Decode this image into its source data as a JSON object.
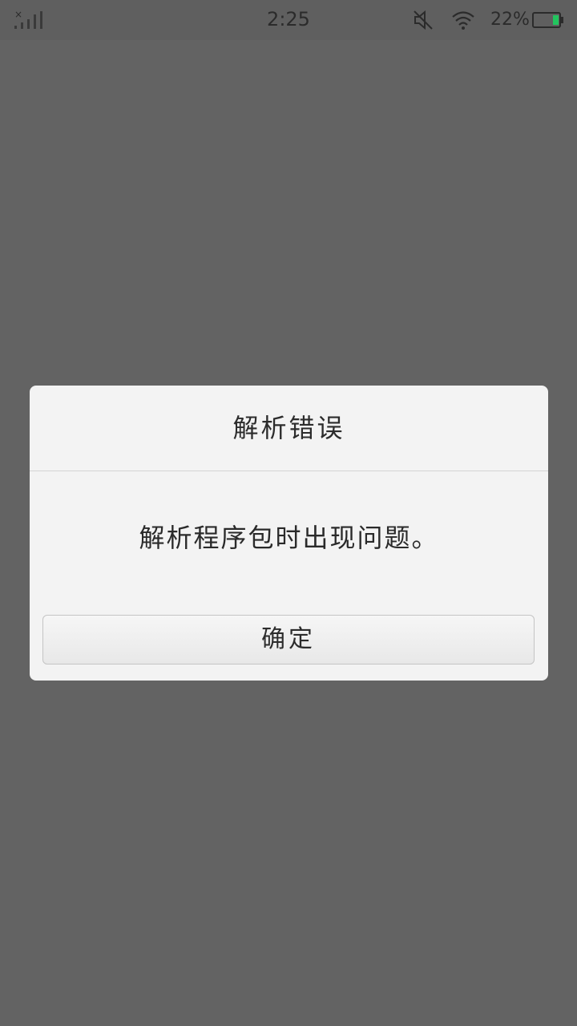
{
  "status_bar": {
    "time": "2:25",
    "battery_percent": "22%",
    "battery_level": 0.22,
    "icons": [
      "no-signal-icon",
      "mute-icon",
      "wifi-icon",
      "battery-icon"
    ],
    "battery_color": "#22c55e"
  },
  "dialog": {
    "title": "解析错误",
    "message": "解析程序包时出现问题。",
    "ok_label": "确定"
  },
  "colors": {
    "background_overlay": "#636363",
    "dialog_background": "#f3f3f3",
    "text": "#2c2c2c"
  }
}
